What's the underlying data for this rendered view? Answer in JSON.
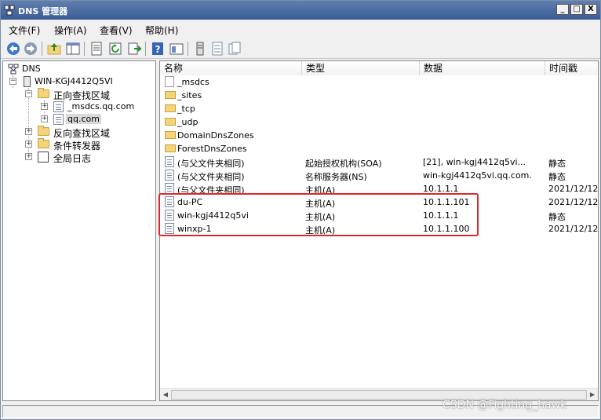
{
  "window": {
    "title": "DNS 管理器",
    "controls": {
      "minimize": "_",
      "maximize": "□",
      "close": "X"
    }
  },
  "menubar": {
    "items": [
      "文件(F)",
      "操作(A)",
      "查看(V)",
      "帮助(H)"
    ]
  },
  "toolbar": {
    "buttons": [
      "back-arrow-icon",
      "forward-arrow-icon",
      "up-folder-icon",
      "show-hide-tree-icon",
      "properties-icon",
      "refresh-icon",
      "export-list-icon",
      "help-icon",
      "mmc-view-icon",
      "server-icon",
      "zone-icon",
      "record-icon"
    ]
  },
  "tree": {
    "root": "DNS",
    "server": "WIN-KGJ4412Q5VI",
    "forward_zones": "正向查找区域",
    "zone_msdcs": "_msdcs.qq.com",
    "zone_qq": "qq.com",
    "reverse_zones": "反向查找区域",
    "conditional_forwarders": "条件转发器",
    "global_logs": "全局日志"
  },
  "list": {
    "columns": [
      "名称",
      "类型",
      "数据",
      "时间戳"
    ],
    "rows": [
      {
        "icon": "zone",
        "name": "_msdcs",
        "type": "",
        "data": "",
        "timestamp": ""
      },
      {
        "icon": "folder",
        "name": "_sites",
        "type": "",
        "data": "",
        "timestamp": ""
      },
      {
        "icon": "folder",
        "name": "_tcp",
        "type": "",
        "data": "",
        "timestamp": ""
      },
      {
        "icon": "folder",
        "name": "_udp",
        "type": "",
        "data": "",
        "timestamp": ""
      },
      {
        "icon": "folder",
        "name": "DomainDnsZones",
        "type": "",
        "data": "",
        "timestamp": ""
      },
      {
        "icon": "folder",
        "name": "ForestDnsZones",
        "type": "",
        "data": "",
        "timestamp": ""
      },
      {
        "icon": "record",
        "name": "(与父文件夹相同)",
        "type": "起始授权机构(SOA)",
        "data": "[21], win-kgj4412q5vi...",
        "timestamp": "静态"
      },
      {
        "icon": "record",
        "name": "(与父文件夹相同)",
        "type": "名称服务器(NS)",
        "data": "win-kgj4412q5vi.qq.com.",
        "timestamp": "静态"
      },
      {
        "icon": "record",
        "name": "(与父文件夹相同)",
        "type": "主机(A)",
        "data": "10.1.1.1",
        "timestamp": "2021/12/12"
      },
      {
        "icon": "record",
        "name": "du-PC",
        "type": "主机(A)",
        "data": "10.1.1.101",
        "timestamp": "2021/12/12"
      },
      {
        "icon": "record",
        "name": "win-kgj4412q5vi",
        "type": "主机(A)",
        "data": "10.1.1.1",
        "timestamp": "静态"
      },
      {
        "icon": "record",
        "name": "winxp-1",
        "type": "主机(A)",
        "data": "10.1.1.100",
        "timestamp": "2021/12/12"
      }
    ]
  },
  "watermark": "CSDN @Fighting_hawk",
  "colors": {
    "highlight_box": "#e0252b",
    "title_bar": "#3b5b95"
  }
}
